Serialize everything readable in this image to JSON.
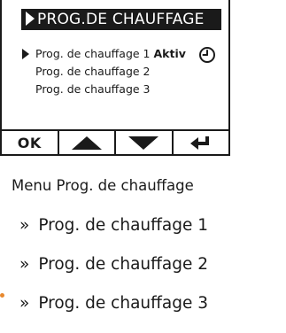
{
  "lcd": {
    "header_title": "PROG.DE CHAUFFAGE",
    "programs": [
      {
        "label": "Prog. de chauffage 1",
        "status": "Aktiv",
        "selected": true
      },
      {
        "label": "Prog. de chauffage 2",
        "status": "",
        "selected": false
      },
      {
        "label": "Prog. de chauffage 3",
        "status": "",
        "selected": false
      }
    ],
    "active_icon": "clock-icon",
    "softkeys": {
      "ok_label": "OK",
      "up_icon": "arrow-up-icon",
      "down_icon": "arrow-down-icon",
      "back_icon": "return-arrow-icon"
    }
  },
  "help": {
    "menu_caption": "Menu Prog. de chauffage",
    "bullet": "»",
    "entries": [
      "Prog. de chauffage 1",
      "Prog. de chauffage 2",
      "Prog. de chauffage 3"
    ]
  },
  "colors": {
    "lcd_ink": "#1a1a1a",
    "background": "#ffffff",
    "edge_marker": "#e8892f"
  }
}
